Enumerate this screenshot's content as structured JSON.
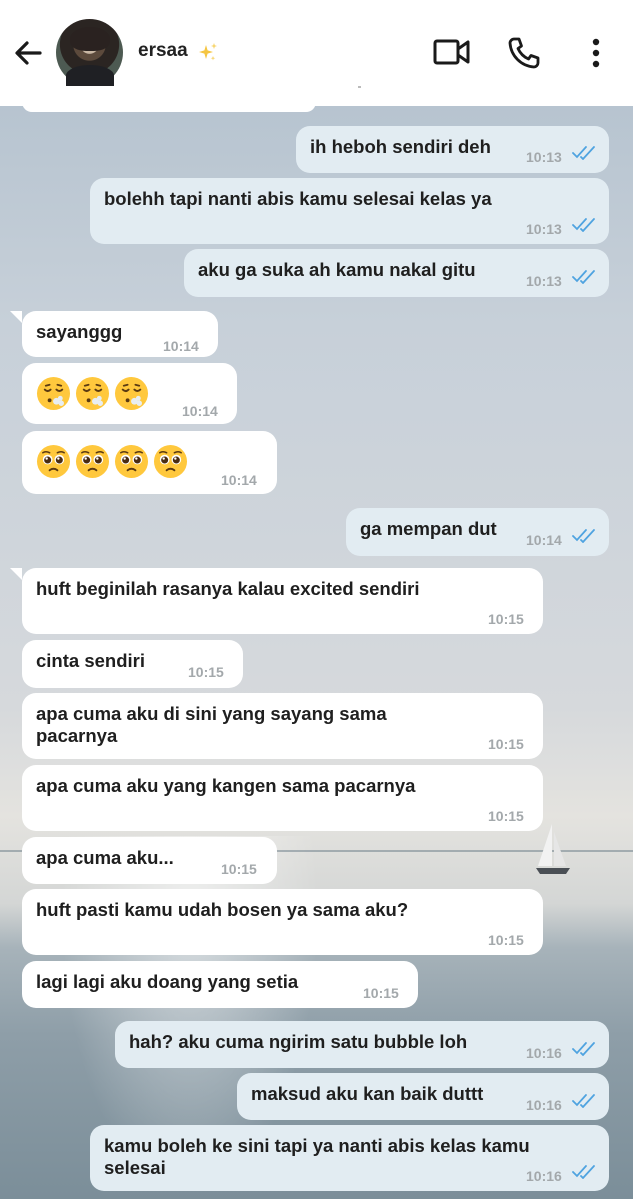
{
  "header": {
    "contact_name": "ersaa",
    "icons": [
      "back-arrow-icon",
      "avatar",
      "sparkles-icon",
      "video-call-icon",
      "phone-call-icon",
      "more-menu-icon"
    ]
  },
  "colors": {
    "outgoing_bubble": "#e2ecf2",
    "incoming_bubble": "#ffffff",
    "read_ticks": "#4fa3e0",
    "timestamp": "#a3a8ab"
  },
  "messages": [
    {
      "dir": "out",
      "text": "ih heboh sendiri deh",
      "time": "10:13",
      "read": true
    },
    {
      "dir": "out",
      "text": "bolehh tapi nanti abis kamu selesai kelas ya",
      "time": "10:13",
      "read": true
    },
    {
      "dir": "out",
      "text": "aku ga suka ah kamu nakal gitu",
      "time": "10:13",
      "read": true
    },
    {
      "dir": "in",
      "text": "sayanggg",
      "time": "10:14"
    },
    {
      "dir": "in",
      "emoji": [
        "exhaling-face",
        "exhaling-face",
        "exhaling-face"
      ],
      "time": "10:14"
    },
    {
      "dir": "in",
      "emoji": [
        "pleading-face",
        "pleading-face",
        "pleading-face",
        "pleading-face"
      ],
      "time": "10:14"
    },
    {
      "dir": "out",
      "text": "ga mempan dut",
      "time": "10:14",
      "read": true
    },
    {
      "dir": "in",
      "text": "huft beginilah rasanya kalau excited sendiri",
      "time": "10:15"
    },
    {
      "dir": "in",
      "text": "cinta sendiri",
      "time": "10:15"
    },
    {
      "dir": "in",
      "text": "apa cuma aku di sini yang sayang sama pacarnya",
      "time": "10:15"
    },
    {
      "dir": "in",
      "text": "apa cuma aku yang kangen sama pacarnya",
      "time": "10:15"
    },
    {
      "dir": "in",
      "text": "apa cuma aku...",
      "time": "10:15"
    },
    {
      "dir": "in",
      "text": "huft pasti kamu udah bosen ya sama aku?",
      "time": "10:15"
    },
    {
      "dir": "in",
      "text": "lagi lagi aku doang yang setia",
      "time": "10:15"
    },
    {
      "dir": "out",
      "text": "hah? aku cuma ngirim satu bubble loh",
      "time": "10:16",
      "read": true
    },
    {
      "dir": "out",
      "text": "maksud aku kan baik duttt",
      "time": "10:16",
      "read": true
    },
    {
      "dir": "out",
      "text": "kamu boleh ke sini tapi ya nanti abis kelas kamu selesai",
      "time": "10:16",
      "read": true
    }
  ]
}
